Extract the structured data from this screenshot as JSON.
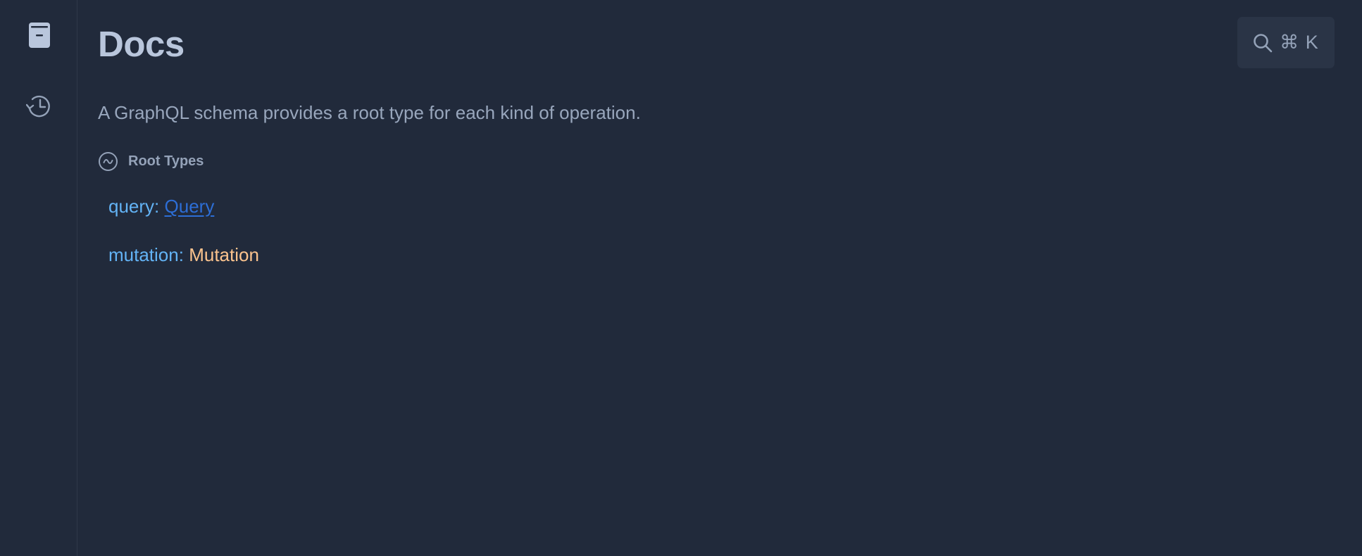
{
  "sidebar": {
    "items": [
      {
        "icon": "docs-book-icon"
      },
      {
        "icon": "history-icon"
      }
    ]
  },
  "main": {
    "title": "Docs",
    "search_shortcut": "⌘ K",
    "description": "A GraphQL schema provides a root type for each kind of operation.",
    "section": {
      "title": "Root Types",
      "fields": [
        {
          "name": "query",
          "separator": ":",
          "type": "Query"
        },
        {
          "name": "mutation",
          "separator": ":",
          "type": "Mutation"
        }
      ]
    }
  },
  "colors": {
    "background": "#212a3b",
    "title": "#b9c6dc",
    "field_name": "#63b3f5",
    "type_link": "#2d6ed6",
    "type_plain": "#fbc38e"
  }
}
